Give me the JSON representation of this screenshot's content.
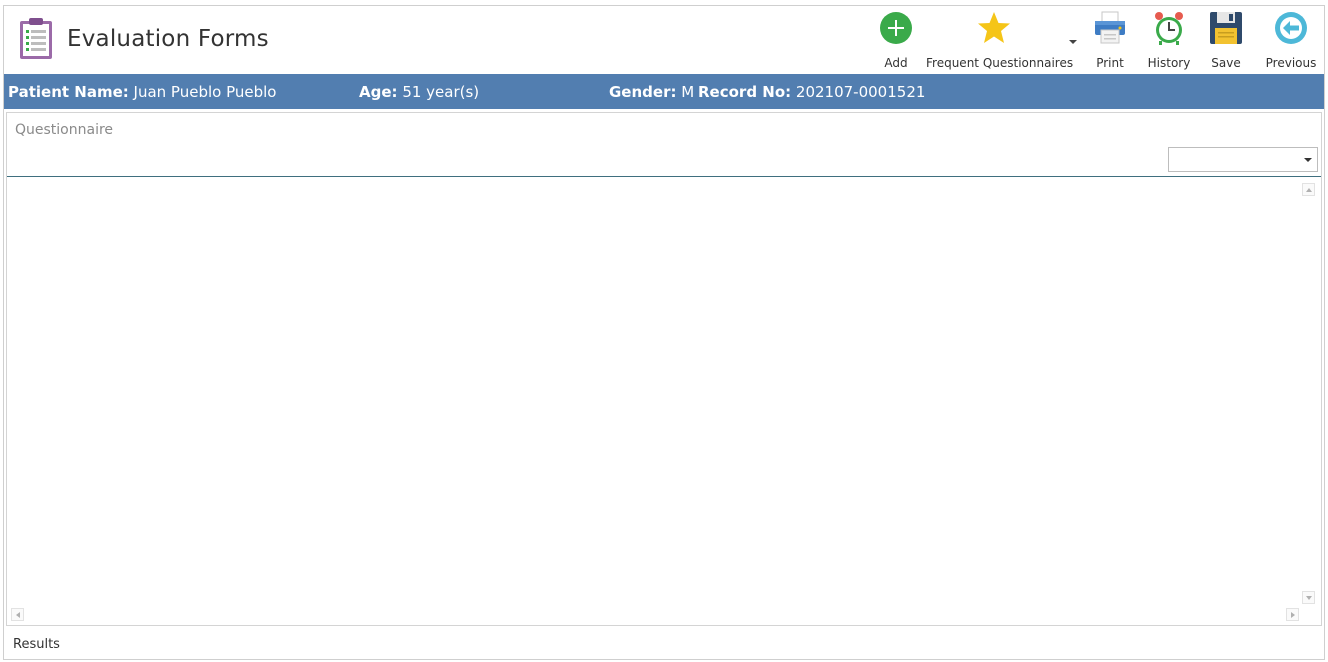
{
  "app": {
    "title": "Evaluation Forms",
    "icon": "clipboard-icon"
  },
  "toolbar": {
    "add": {
      "label": "Add",
      "icon": "plus-circle-icon",
      "color": "#3aaa4a"
    },
    "frequent": {
      "label": "Frequent Questionnaires",
      "icon": "star-icon",
      "color": "#f5c518"
    },
    "print": {
      "label": "Print",
      "icon": "printer-icon"
    },
    "history": {
      "label": "History",
      "icon": "alarm-clock-icon"
    },
    "save": {
      "label": "Save",
      "icon": "floppy-disk-icon"
    },
    "previous": {
      "label": "Previous",
      "icon": "arrow-left-circle-icon",
      "color": "#4db8d8"
    }
  },
  "patient": {
    "bar_color": "#527eb0",
    "name_label": "Patient Name:",
    "name_value": "Juan Pueblo Pueblo",
    "age_label": "Age:",
    "age_value": "51 year(s)",
    "gender_label": "Gender:",
    "gender_value": "M",
    "record_label": "Record No:",
    "record_value": "202107-0001521"
  },
  "questionnaire": {
    "label": "Questionnaire",
    "selected": ""
  },
  "footer": {
    "results_label": "Results"
  }
}
